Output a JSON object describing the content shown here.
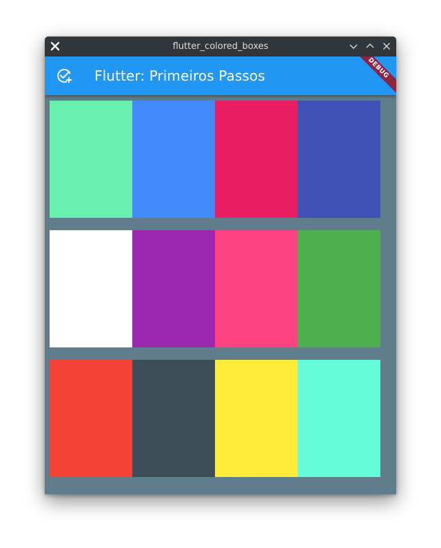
{
  "window": {
    "title": "flutter_colored_boxes",
    "controls": [
      "minimize",
      "maximize",
      "close"
    ]
  },
  "appbar": {
    "title": "Flutter: Primeiros Passos",
    "leading_icon": "add-task-icon",
    "color": "#2196f3"
  },
  "debug_banner": {
    "label": "DEBUG",
    "color": "#8d2541"
  },
  "body": {
    "background": "#607d8b",
    "rows": [
      {
        "colors": [
          "#69f0ae",
          "#448aff",
          "#e91e63",
          "#3f51b5"
        ]
      },
      {
        "colors": [
          "#ffffff",
          "#9c27b0",
          "#ff4081",
          "#4caf50"
        ]
      },
      {
        "colors": [
          "#f44336",
          "#3c4d55",
          "#ffeb3b",
          "#64ffda"
        ]
      }
    ]
  }
}
